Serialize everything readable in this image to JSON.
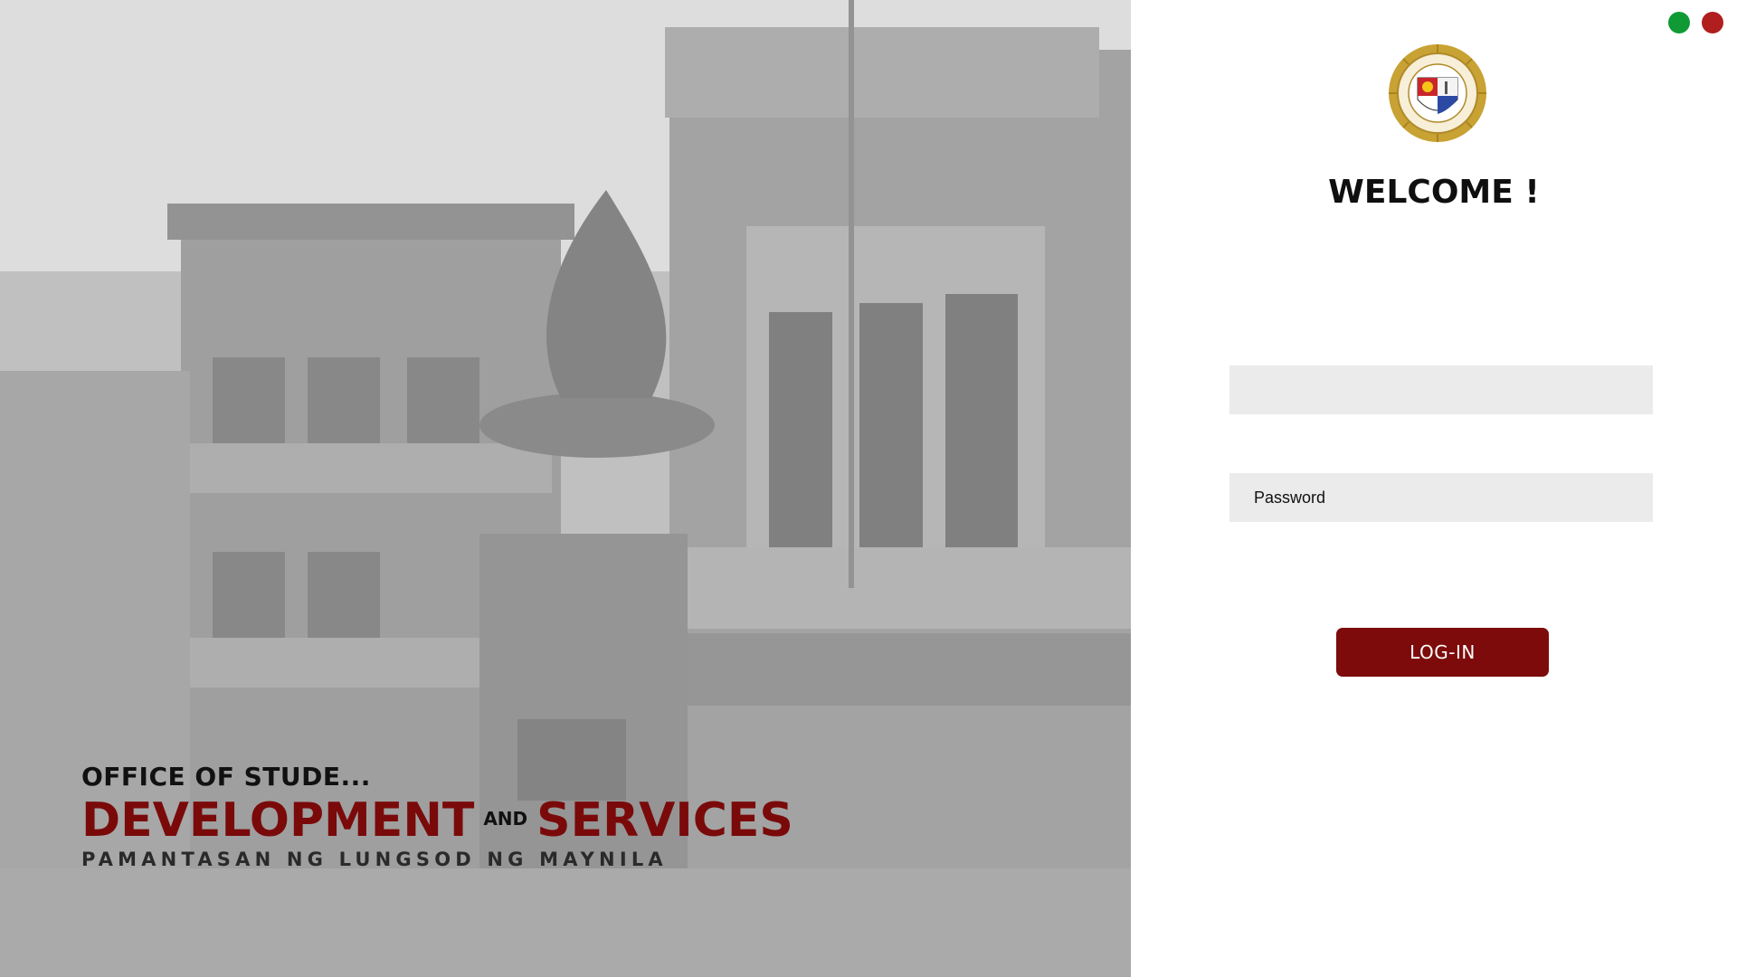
{
  "window": {
    "controls": [
      {
        "name": "green-dot",
        "color": "#0f9a35"
      },
      {
        "name": "red-dot",
        "color": "#b01e1e"
      }
    ]
  },
  "branding": {
    "office": "OFFICE OF STUDE...",
    "development": "DEVELOPMENT",
    "and": "AND",
    "services": "SERVICES",
    "university": "PAMANTASAN NG LUNGSOD NG MAYNILA"
  },
  "login": {
    "welcome": "WELCOME !",
    "username_value": "",
    "password_placeholder": "Password",
    "button_label": "LOG-IN"
  },
  "colors": {
    "accent": "#7d0b0b",
    "field_bg": "#ebebeb"
  }
}
